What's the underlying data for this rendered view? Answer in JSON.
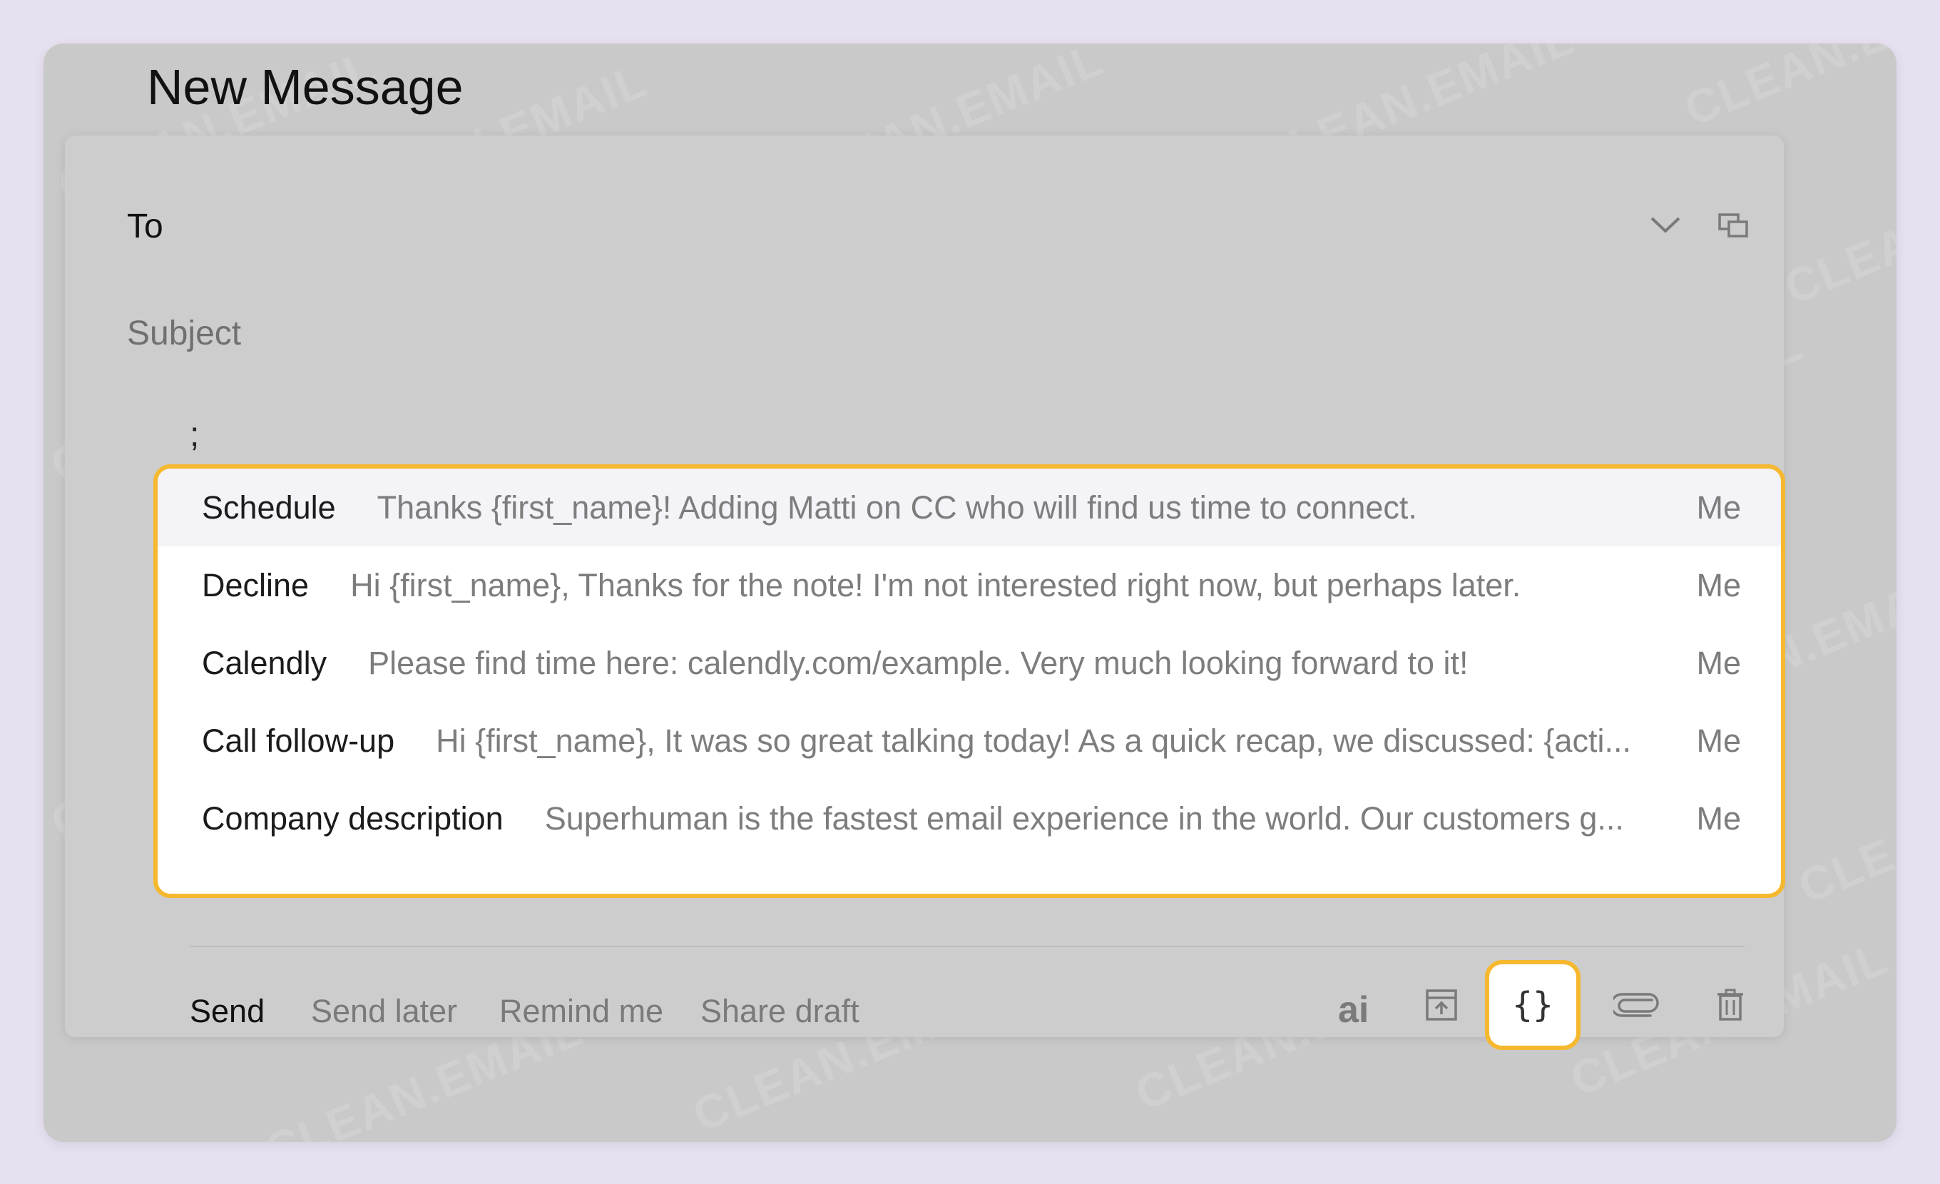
{
  "compose": {
    "title": "New Message",
    "to_label": "To",
    "subject_placeholder": "Subject",
    "body_text": ";"
  },
  "snippets": [
    {
      "name": "Schedule",
      "preview": "Thanks {first_name}! Adding Matti on CC who will find us time to connect.",
      "owner": "Me",
      "selected": true
    },
    {
      "name": "Decline",
      "preview": "Hi {first_name}, Thanks for the note! I'm not interested right now, but perhaps later.",
      "owner": "Me",
      "selected": false
    },
    {
      "name": "Calendly",
      "preview": "Please find time here: calendly.com/example. Very much looking forward to it!",
      "owner": "Me",
      "selected": false
    },
    {
      "name": "Call follow-up",
      "preview": "Hi {first_name}, It was so great talking today! As a quick recap, we discussed: {acti...",
      "owner": "Me",
      "selected": false
    },
    {
      "name": "Company description",
      "preview": "Superhuman is the fastest email experience in the world. Our customers g...",
      "owner": "Me",
      "selected": false
    }
  ],
  "toolbar": {
    "send": "Send",
    "send_later": "Send later",
    "remind_me": "Remind me",
    "share_draft": "Share draft",
    "ai": "ai",
    "snippets_icon": "{}"
  },
  "watermark": "CLEAN.EMAIL",
  "colors": {
    "highlight": "#f5b82e",
    "background": "#e6e0f0"
  }
}
